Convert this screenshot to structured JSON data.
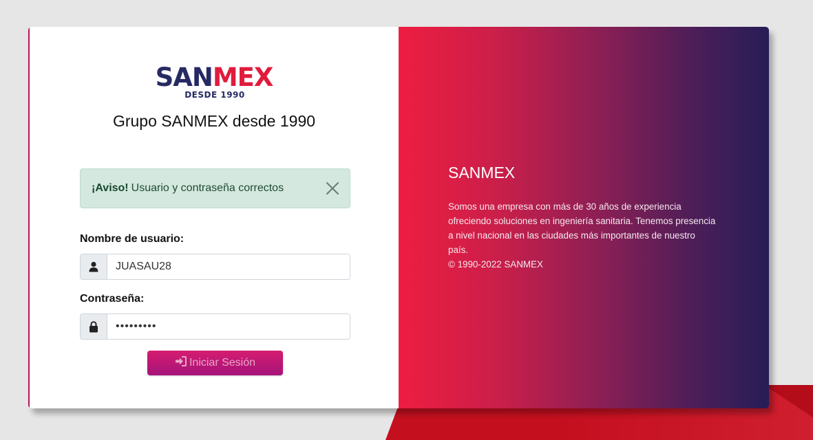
{
  "brand": {
    "logo_part1": "SAN",
    "logo_part2": "MEX",
    "logo_tagline": "DESDE 1990",
    "subtitle": "Grupo SANMEX desde 1990",
    "colors": {
      "navy": "#262a63",
      "red": "#e11b3c",
      "magenta": "#b5125f"
    }
  },
  "alert": {
    "strong": "¡Aviso!",
    "message": "Usuario y contraseña correctos",
    "close_icon": "close-icon"
  },
  "form": {
    "username_label": "Nombre de usuario:",
    "username_value": "JUASAU28",
    "username_icon": "user-icon",
    "password_label": "Contraseña:",
    "password_value": "•••••••••",
    "password_icon": "lock-icon",
    "submit_label": "Iniciar Sesión",
    "submit_icon": "sign-in-icon"
  },
  "info": {
    "title": "SANMEX",
    "description": "Somos una empresa con más de 30 años de experiencia ofreciendo soluciones en ingeniería sanitaria. Tenemos presencia a nivel nacional en las ciudades más importantes de nuestro país.",
    "copyright": "© 1990-2022 SANMEX"
  }
}
